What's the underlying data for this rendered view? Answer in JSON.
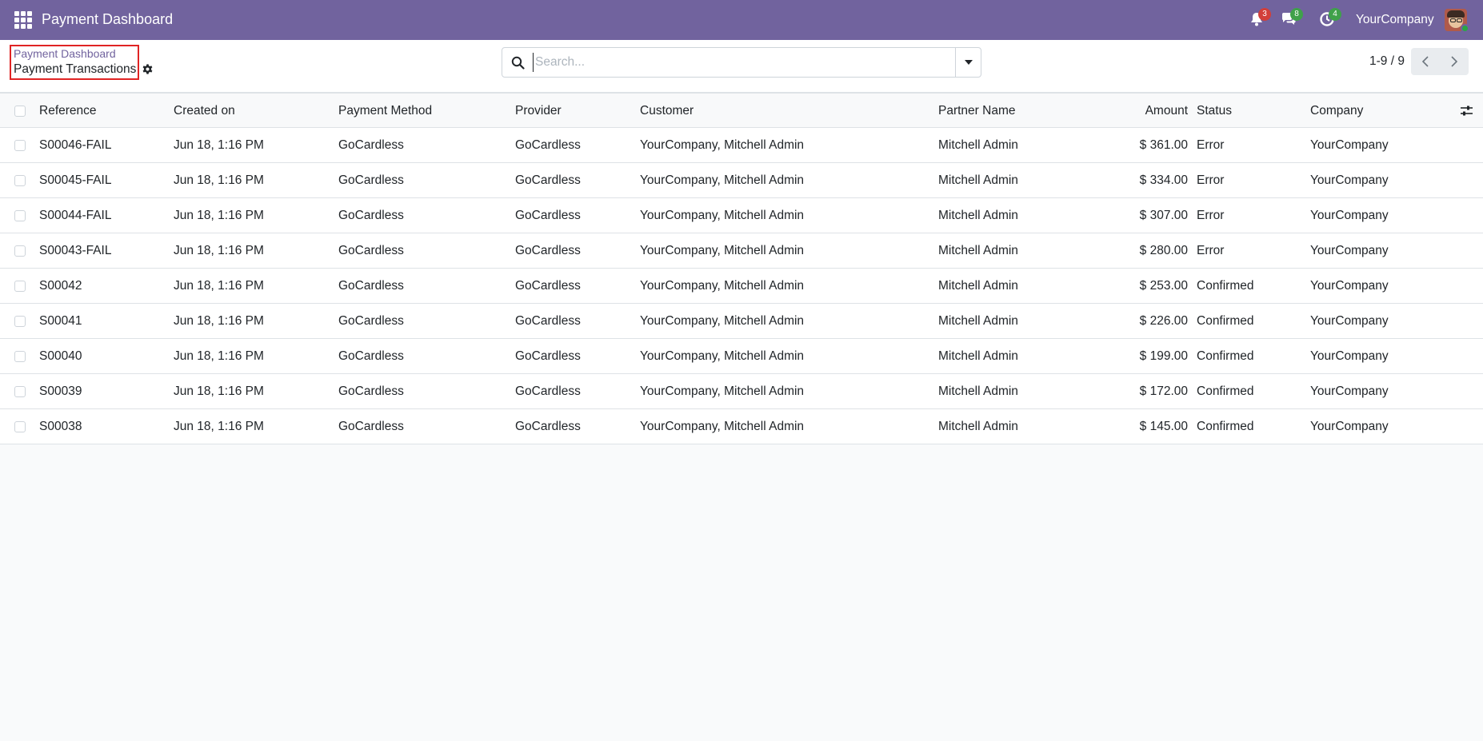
{
  "navbar": {
    "app_title": "Payment Dashboard",
    "activity_count": "3",
    "messages_count": "8",
    "clock_count": "4",
    "company": "YourCompany"
  },
  "breadcrumb": {
    "parent": "Payment Dashboard",
    "current": "Payment Transactions"
  },
  "search": {
    "placeholder": "Search...",
    "value": ""
  },
  "pager": {
    "value": "1-9 / 9"
  },
  "table": {
    "headers": {
      "reference": "Reference",
      "created_on": "Created on",
      "payment_method": "Payment Method",
      "provider": "Provider",
      "customer": "Customer",
      "partner_name": "Partner Name",
      "amount": "Amount",
      "status": "Status",
      "company": "Company"
    },
    "rows": [
      {
        "reference": "S00046-FAIL",
        "created_on": "Jun 18, 1:16 PM",
        "payment_method": "GoCardless",
        "provider": "GoCardless",
        "customer": "YourCompany, Mitchell Admin",
        "partner_name": "Mitchell Admin",
        "amount": "$ 361.00",
        "status": "Error",
        "company": "YourCompany"
      },
      {
        "reference": "S00045-FAIL",
        "created_on": "Jun 18, 1:16 PM",
        "payment_method": "GoCardless",
        "provider": "GoCardless",
        "customer": "YourCompany, Mitchell Admin",
        "partner_name": "Mitchell Admin",
        "amount": "$ 334.00",
        "status": "Error",
        "company": "YourCompany"
      },
      {
        "reference": "S00044-FAIL",
        "created_on": "Jun 18, 1:16 PM",
        "payment_method": "GoCardless",
        "provider": "GoCardless",
        "customer": "YourCompany, Mitchell Admin",
        "partner_name": "Mitchell Admin",
        "amount": "$ 307.00",
        "status": "Error",
        "company": "YourCompany"
      },
      {
        "reference": "S00043-FAIL",
        "created_on": "Jun 18, 1:16 PM",
        "payment_method": "GoCardless",
        "provider": "GoCardless",
        "customer": "YourCompany, Mitchell Admin",
        "partner_name": "Mitchell Admin",
        "amount": "$ 280.00",
        "status": "Error",
        "company": "YourCompany"
      },
      {
        "reference": "S00042",
        "created_on": "Jun 18, 1:16 PM",
        "payment_method": "GoCardless",
        "provider": "GoCardless",
        "customer": "YourCompany, Mitchell Admin",
        "partner_name": "Mitchell Admin",
        "amount": "$ 253.00",
        "status": "Confirmed",
        "company": "YourCompany"
      },
      {
        "reference": "S00041",
        "created_on": "Jun 18, 1:16 PM",
        "payment_method": "GoCardless",
        "provider": "GoCardless",
        "customer": "YourCompany, Mitchell Admin",
        "partner_name": "Mitchell Admin",
        "amount": "$ 226.00",
        "status": "Confirmed",
        "company": "YourCompany"
      },
      {
        "reference": "S00040",
        "created_on": "Jun 18, 1:16 PM",
        "payment_method": "GoCardless",
        "provider": "GoCardless",
        "customer": "YourCompany, Mitchell Admin",
        "partner_name": "Mitchell Admin",
        "amount": "$ 199.00",
        "status": "Confirmed",
        "company": "YourCompany"
      },
      {
        "reference": "S00039",
        "created_on": "Jun 18, 1:16 PM",
        "payment_method": "GoCardless",
        "provider": "GoCardless",
        "customer": "YourCompany, Mitchell Admin",
        "partner_name": "Mitchell Admin",
        "amount": "$ 172.00",
        "status": "Confirmed",
        "company": "YourCompany"
      },
      {
        "reference": "S00038",
        "created_on": "Jun 18, 1:16 PM",
        "payment_method": "GoCardless",
        "provider": "GoCardless",
        "customer": "YourCompany, Mitchell Admin",
        "partner_name": "Mitchell Admin",
        "amount": "$ 145.00",
        "status": "Confirmed",
        "company": "YourCompany"
      }
    ]
  },
  "icons": {
    "apps": "apps-grid-icon",
    "activity": "bell-icon",
    "messages": "chat-bubbles-icon",
    "clock": "clock-icon",
    "settings": "gear-icon",
    "search": "search-icon",
    "toggle": "caret-down-icon",
    "prev": "chevron-left-icon",
    "next": "chevron-right-icon",
    "optional_columns": "sliders-icon"
  },
  "colors": {
    "brand": "#71639e",
    "highlight_border": "#e02424",
    "badge_red": "#d23f3a",
    "badge_green": "#3fa14a"
  }
}
